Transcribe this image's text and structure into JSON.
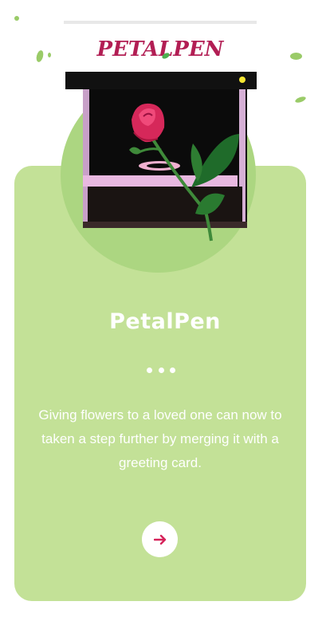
{
  "product": {
    "brand_logo_text": "PETALPEN",
    "title": "PetalPen",
    "description": "Giving flowers to a loved one can now to taken a step further by merging it with a greeting card.",
    "image_icon": "rose-in-machine-image",
    "next_icon": "arrow-right-icon"
  },
  "colors": {
    "card_bg": "#c3e197",
    "circle_bg": "#acd681",
    "title_text": "#ffffff",
    "arrow": "#d6235a",
    "logo": "#b21e54"
  },
  "pagination": {
    "dot_count": 3
  }
}
